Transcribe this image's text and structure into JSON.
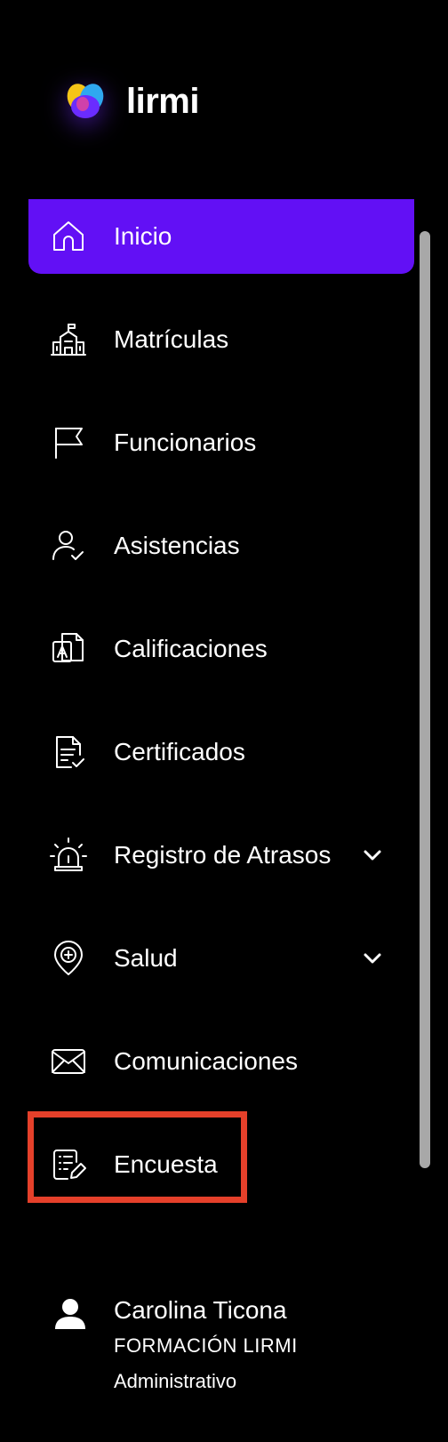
{
  "brand": {
    "name": "lirmi",
    "accent": "#6210f5",
    "highlight": "#e5402a"
  },
  "nav": {
    "items": [
      {
        "label": "Inicio",
        "icon": "home-icon",
        "active": true
      },
      {
        "label": "Matrículas",
        "icon": "school-icon"
      },
      {
        "label": "Funcionarios",
        "icon": "flag-icon"
      },
      {
        "label": "Asistencias",
        "icon": "user-check-icon"
      },
      {
        "label": "Calificaciones",
        "icon": "grade-document-icon"
      },
      {
        "label": "Certificados",
        "icon": "certificate-icon"
      },
      {
        "label": "Registro de Atrasos",
        "icon": "alarm-icon",
        "expandable": true
      },
      {
        "label": "Salud",
        "icon": "health-pin-icon",
        "expandable": true
      },
      {
        "label": "Comunicaciones",
        "icon": "mail-icon"
      },
      {
        "label": "Encuesta",
        "icon": "survey-icon",
        "highlighted": true
      }
    ]
  },
  "user": {
    "name": "Carolina Ticona",
    "organization": "FORMACIÓN LIRMI",
    "role": "Administrativo",
    "icon": "user-icon"
  }
}
